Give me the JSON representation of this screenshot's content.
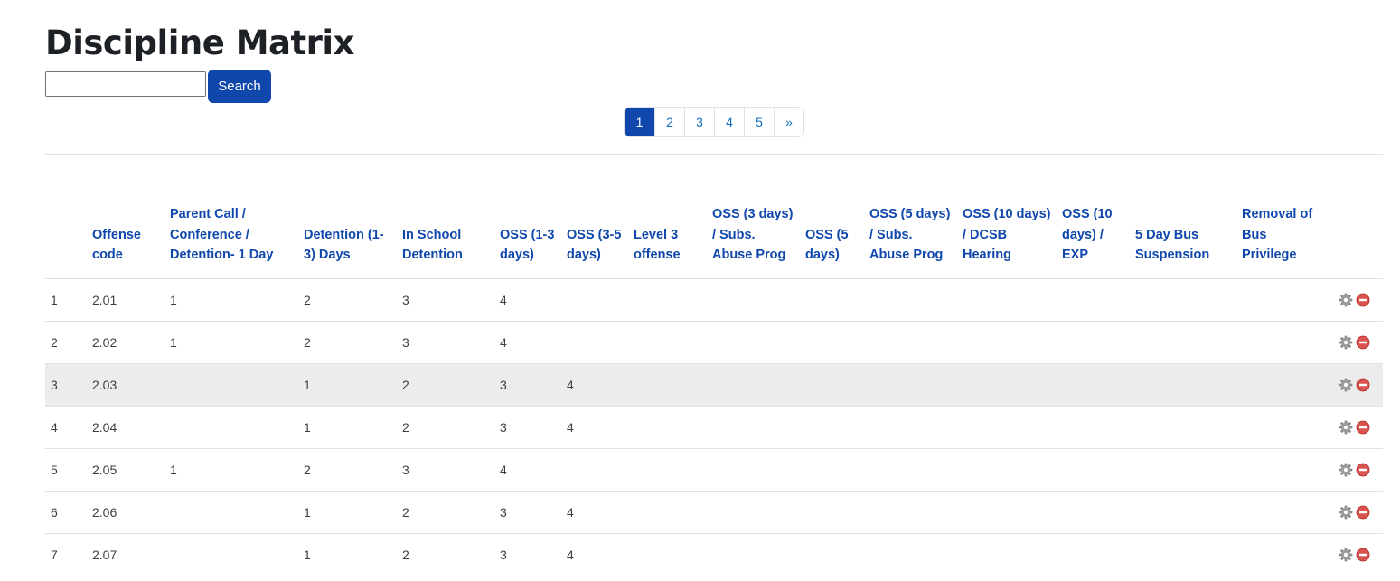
{
  "page": {
    "title": "Discipline Matrix"
  },
  "search": {
    "value": "",
    "placeholder": "",
    "button_label": "Search"
  },
  "pagination": {
    "pages": [
      "1",
      "2",
      "3",
      "4",
      "5"
    ],
    "next": "»",
    "current": "1"
  },
  "table": {
    "headers": [
      "",
      "Offense code",
      "Parent Call / Conference / Detention- 1 Day",
      "Detention (1-3) Days",
      "In School Detention",
      "OSS (1-3 days)",
      "OSS (3-5 days)",
      "Level 3 offense",
      "OSS (3 days) / Subs. Abuse Prog",
      "OSS (5 days)",
      "OSS (5 days) / Subs. Abuse Prog",
      "OSS (10 days) / DCSB Hearing",
      "OSS (10 days) / EXP",
      "5 Day Bus Suspension",
      "Removal of Bus Privilege",
      ""
    ],
    "rows": [
      [
        "1",
        "2.01",
        "1",
        "2",
        "3",
        "4",
        "",
        "",
        "",
        "",
        "",
        "",
        "",
        "",
        ""
      ],
      [
        "2",
        "2.02",
        "1",
        "2",
        "3",
        "4",
        "",
        "",
        "",
        "",
        "",
        "",
        "",
        "",
        ""
      ],
      [
        "3",
        "2.03",
        "",
        "1",
        "2",
        "3",
        "4",
        "",
        "",
        "",
        "",
        "",
        "",
        "",
        ""
      ],
      [
        "4",
        "2.04",
        "",
        "1",
        "2",
        "3",
        "4",
        "",
        "",
        "",
        "",
        "",
        "",
        "",
        ""
      ],
      [
        "5",
        "2.05",
        "1",
        "2",
        "3",
        "4",
        "",
        "",
        "",
        "",
        "",
        "",
        "",
        "",
        ""
      ],
      [
        "6",
        "2.06",
        "",
        "1",
        "2",
        "3",
        "4",
        "",
        "",
        "",
        "",
        "",
        "",
        "",
        ""
      ],
      [
        "7",
        "2.07",
        "",
        "1",
        "2",
        "3",
        "4",
        "",
        "",
        "",
        "",
        "",
        "",
        "",
        ""
      ]
    ],
    "highlighted_row": 2,
    "row_action_icons": [
      "gear-icon",
      "remove-icon"
    ]
  },
  "colors": {
    "primary": "#0f47ad",
    "link": "#0f6cbf",
    "row_highlight": "#ececec",
    "remove": "#d9534f"
  }
}
